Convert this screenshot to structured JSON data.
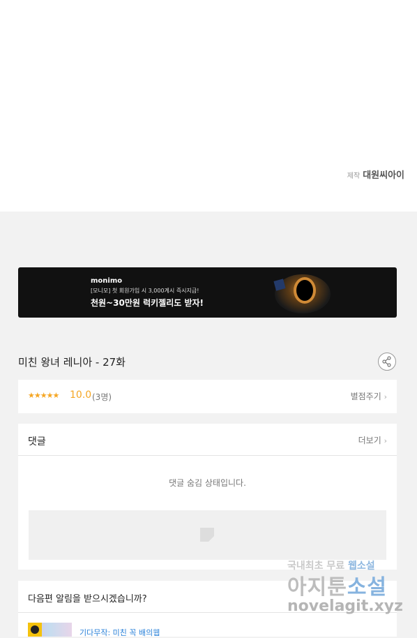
{
  "credit": {
    "label": "제작",
    "studio": "대원씨아이"
  },
  "banner": {
    "brand": "monimo",
    "line1": "[모니모] 첫 회원가입 시 3,000계시 즉시지급!",
    "line2": "천원~30만원 럭키젤리도 받자!"
  },
  "episode": {
    "title": "미친 왕녀 레니아 - 27화"
  },
  "rating": {
    "stars": "★★★★★",
    "score": "10.0",
    "count": "(3명)",
    "rate_button": "별점주기"
  },
  "comments": {
    "title": "댓글",
    "more": "더보기",
    "hidden_message": "댓글 숨김 상태입니다."
  },
  "notify": {
    "question": "다음편 알림을 받으시겠습니까?",
    "teaser": "기다무작: 미친 꼭 배의웹"
  },
  "watermark": {
    "line1_a": "국내최초 무료",
    "line1_b": "웹소설",
    "line2_a": "아지툰",
    "line2_b": "소설",
    "line3": "novelagit.xyz"
  },
  "icons": {
    "share": "share-icon",
    "chevron": "chevron-right-icon"
  },
  "colors": {
    "accent": "#f5a623",
    "link": "#2b82d9"
  }
}
